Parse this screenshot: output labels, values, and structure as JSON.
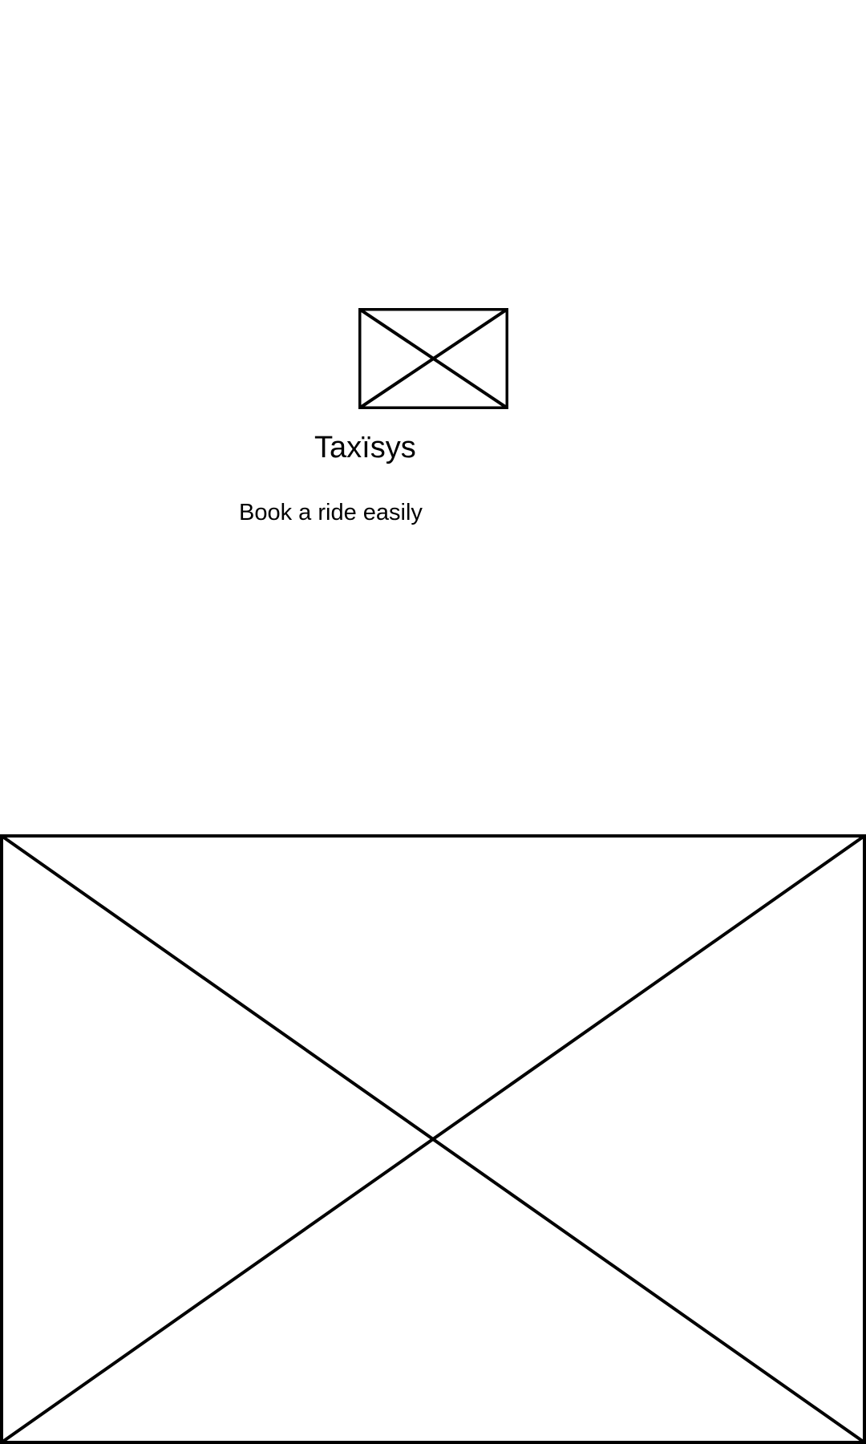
{
  "splash": {
    "logo": {
      "icon": "image-placeholder-icon"
    },
    "app_name": "Taxïsys",
    "tagline": "Book a ride easily"
  },
  "hero": {
    "icon": "image-placeholder-icon"
  },
  "colors": {
    "background": "#ffffff",
    "foreground": "#000000"
  }
}
